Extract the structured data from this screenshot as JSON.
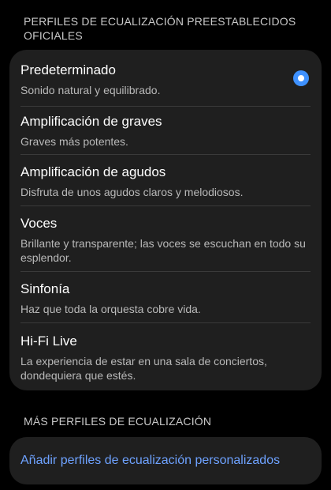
{
  "sections": {
    "official_header": "PERFILES DE ECUALIZACIÓN PREESTABLECIDOS OFICIALES",
    "more_header": "MÁS PERFILES DE ECUALIZACIÓN"
  },
  "presets": [
    {
      "title": "Predeterminado",
      "subtitle": "Sonido natural y equilibrado.",
      "selected": true
    },
    {
      "title": "Amplificación de graves",
      "subtitle": "Graves más potentes.",
      "selected": false
    },
    {
      "title": "Amplificación de agudos",
      "subtitle": "Disfruta de unos agudos claros y melodiosos.",
      "selected": false
    },
    {
      "title": "Voces",
      "subtitle": "Brillante y transparente; las voces se escuchan en todo su esplendor.",
      "selected": false
    },
    {
      "title": "Sinfonía",
      "subtitle": "Haz que toda la orquesta cobre vida.",
      "selected": false
    },
    {
      "title": "Hi-Fi Live",
      "subtitle": "La experiencia de estar en una sala de conciertos, dondequiera que estés.",
      "selected": false
    }
  ],
  "more": {
    "add_custom_label": "Añadir perfiles de ecualización personalizados"
  },
  "colors": {
    "background": "#000000",
    "card": "#1f1f1f",
    "accent": "#3e91ff",
    "link": "#6ea2ff"
  },
  "icons": {
    "selected_radio": "radio-selected-icon"
  }
}
